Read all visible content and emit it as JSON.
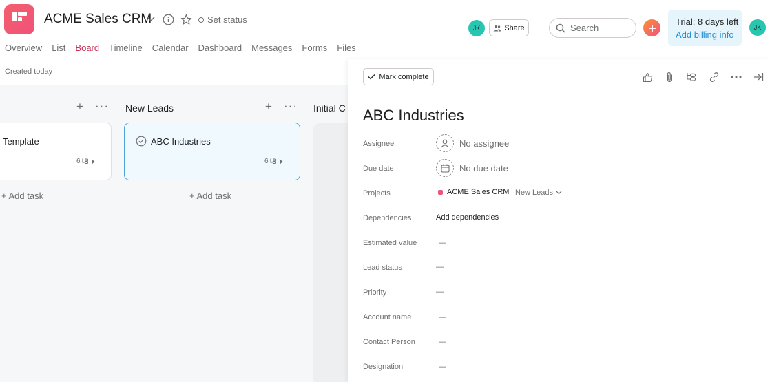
{
  "header": {
    "project_title": "ACME Sales CRM",
    "set_status": "Set status",
    "tabs": [
      {
        "label": "Overview"
      },
      {
        "label": "List"
      },
      {
        "label": "Board"
      },
      {
        "label": "Timeline"
      },
      {
        "label": "Calendar"
      },
      {
        "label": "Dashboard"
      },
      {
        "label": "Messages"
      },
      {
        "label": "Forms"
      },
      {
        "label": "Files"
      }
    ],
    "active_tab": "Board",
    "member_initials": "JK",
    "share_label": "Share",
    "search_placeholder": "Search",
    "trial_text": "Trial: 8 days left",
    "billing_link": "Add billing info",
    "user_initials": "JK"
  },
  "subheader": {
    "created": "Created today"
  },
  "board": {
    "columns": [
      {
        "name": "",
        "cards": [
          {
            "title": "Template",
            "subtasks": "6"
          }
        ],
        "add_task": "+ Add task"
      },
      {
        "name": "New Leads",
        "cards": [
          {
            "title": "ABC Industries",
            "subtasks": "6"
          }
        ],
        "add_task": "+ Add task"
      },
      {
        "name": "Initial C",
        "cards": [],
        "add_task": ""
      }
    ]
  },
  "detail": {
    "mark_complete": "Mark complete",
    "title": "ABC Industries",
    "fields": {
      "assignee": {
        "label": "Assignee",
        "value": "No assignee"
      },
      "due_date": {
        "label": "Due date",
        "value": "No due date"
      },
      "projects": {
        "label": "Projects",
        "project": "ACME Sales CRM",
        "section": "New Leads"
      },
      "dependencies": {
        "label": "Dependencies",
        "value": "Add dependencies"
      },
      "estimated_value": {
        "label": "Estimated value",
        "value": "—"
      },
      "lead_status": {
        "label": "Lead status",
        "value": "—"
      },
      "priority": {
        "label": "Priority",
        "value": "—"
      },
      "account_name": {
        "label": "Account name",
        "value": "—"
      },
      "contact_person": {
        "label": "Contact Person",
        "value": "—"
      },
      "designation": {
        "label": "Designation",
        "value": "—"
      }
    }
  },
  "colors": {
    "accent": "#f06a6a",
    "link": "#1d8fd6",
    "avatar": "#26c6b0",
    "selected_border": "#4ba6d6"
  }
}
